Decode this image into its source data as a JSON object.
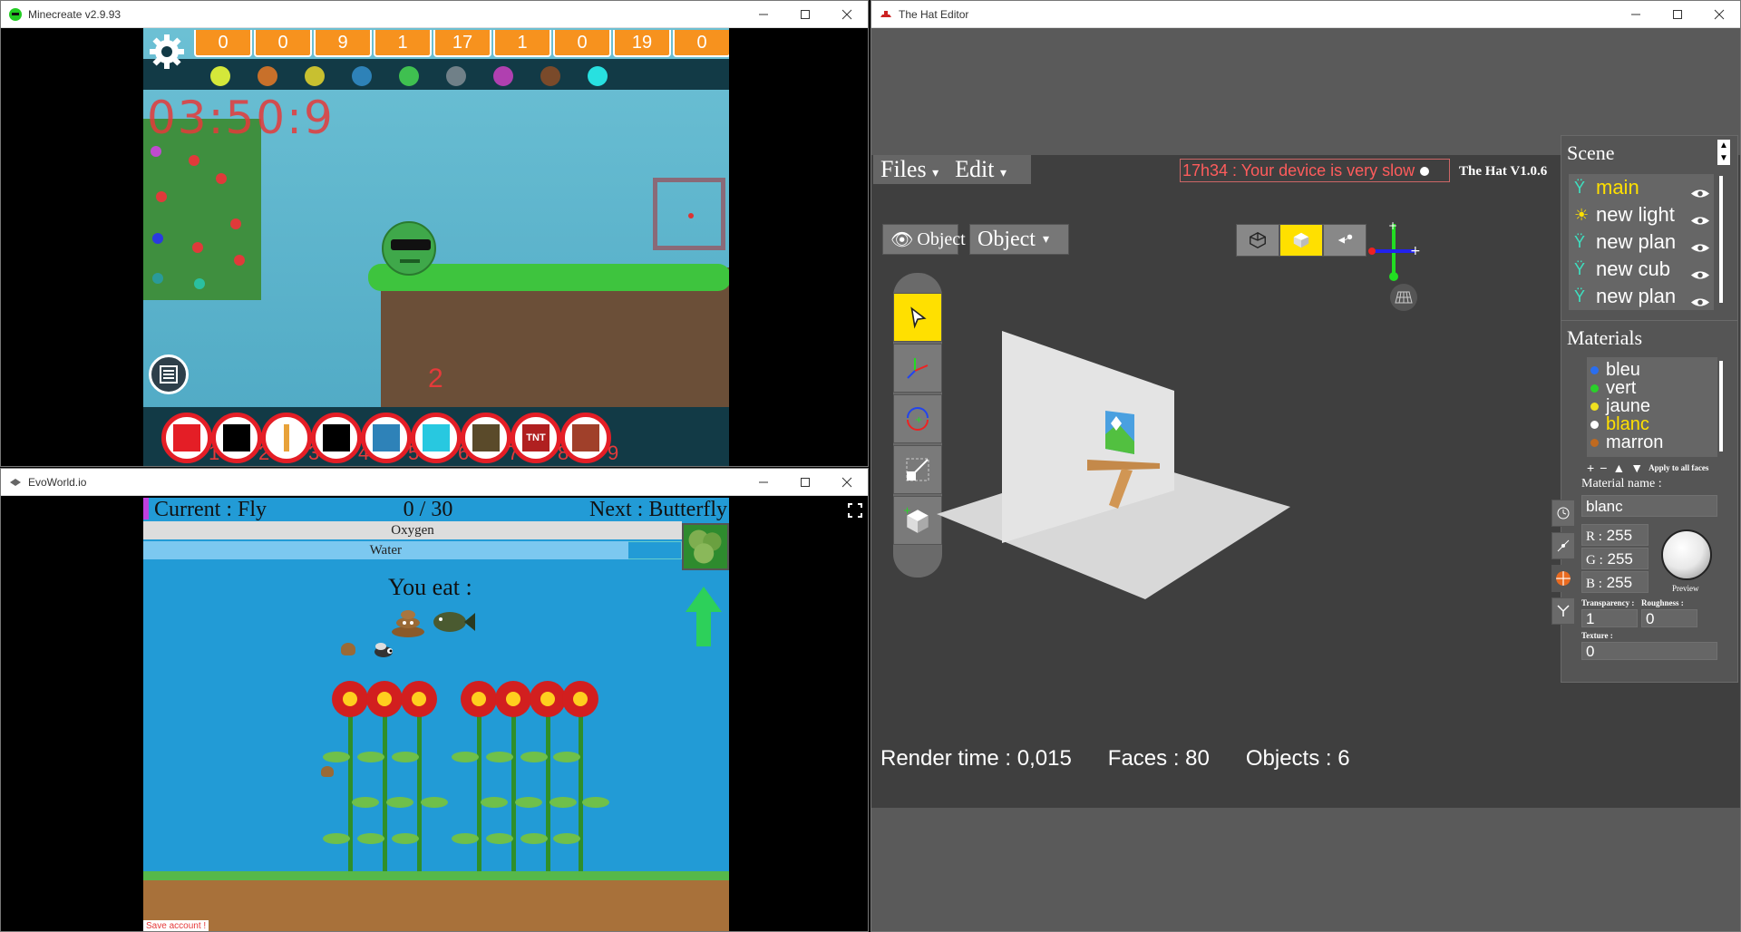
{
  "windows": {
    "minecreate": {
      "title": "Minecreate v2.9.93"
    },
    "evoworld": {
      "title": "EvoWorld.io"
    },
    "hat": {
      "title": "The Hat Editor"
    }
  },
  "minecreate": {
    "counters": [
      "0",
      "0",
      "9",
      "1",
      "17",
      "1",
      "0",
      "19",
      "0"
    ],
    "ore_colors": [
      "#d4e83a",
      "#c8702a",
      "#c8c030",
      "#2e82b8",
      "#3fc050",
      "#708088",
      "#b040b0",
      "#7a4a2a",
      "#28e0e0"
    ],
    "timer": "03:50:9",
    "floating_number": "2",
    "hotbar_numbers": [
      "1",
      "2",
      "3",
      "4",
      "5",
      "6",
      "7",
      "8",
      "9"
    ],
    "hotbar_icons": [
      "fist-icon",
      "black-block-icon",
      "torch-icon",
      "furnace-icon",
      "blue-block-icon",
      "cyan-block-icon",
      "lightning-block-icon",
      "tnt-icon",
      "brick-block-icon"
    ],
    "tnt_label": "TNT"
  },
  "evoworld": {
    "current": "Current : Fly",
    "progress": "0 / 30",
    "next": "Next : Butterfly",
    "oxygen_label": "Oxygen",
    "water_label": "Water",
    "oxygen_level": 1.0,
    "water_level": 0.9,
    "you_eat": "You eat :",
    "save_account": "Save account !"
  },
  "hat": {
    "menu": {
      "files": "Files",
      "edit": "Edit"
    },
    "warning": "17h34 : Your device is very slow",
    "version": "The Hat V1.0.6",
    "object_toggle": "Object",
    "object_mode": "Object",
    "stats": {
      "render_time": "Render time : 0,015",
      "faces": "Faces : 80",
      "objects": "Objects : 6"
    },
    "scene": {
      "title": "Scene",
      "items": [
        {
          "label": "main",
          "icon": "object-icon",
          "selected": true
        },
        {
          "label": "new light",
          "icon": "light-icon",
          "selected": false
        },
        {
          "label": "new plan",
          "icon": "object-icon",
          "selected": false
        },
        {
          "label": "new cub",
          "icon": "object-icon",
          "selected": false
        },
        {
          "label": "new plan",
          "icon": "object-icon",
          "selected": false
        }
      ]
    },
    "materials": {
      "title": "Materials",
      "items": [
        {
          "label": "bleu",
          "color": "#2a6ef0",
          "selected": false
        },
        {
          "label": "vert",
          "color": "#2ad02a",
          "selected": false
        },
        {
          "label": "jaune",
          "color": "#f0e020",
          "selected": false
        },
        {
          "label": "blanc",
          "color": "#ffffff",
          "selected": true
        },
        {
          "label": "marron",
          "color": "#c06a20",
          "selected": false
        }
      ],
      "apply_all": "Apply to all faces",
      "name_label": "Material name :",
      "name_value": "blanc",
      "r_label": "R :",
      "r_value": "255",
      "g_label": "G :",
      "g_value": "255",
      "b_label": "B :",
      "b_value": "255",
      "preview_label": "Preview",
      "transparency_label": "Transparency :",
      "transparency_value": "1",
      "roughness_label": "Roughness :",
      "roughness_value": "0",
      "texture_label": "Texture :",
      "texture_value": "0"
    },
    "accent": "#ffe000"
  }
}
